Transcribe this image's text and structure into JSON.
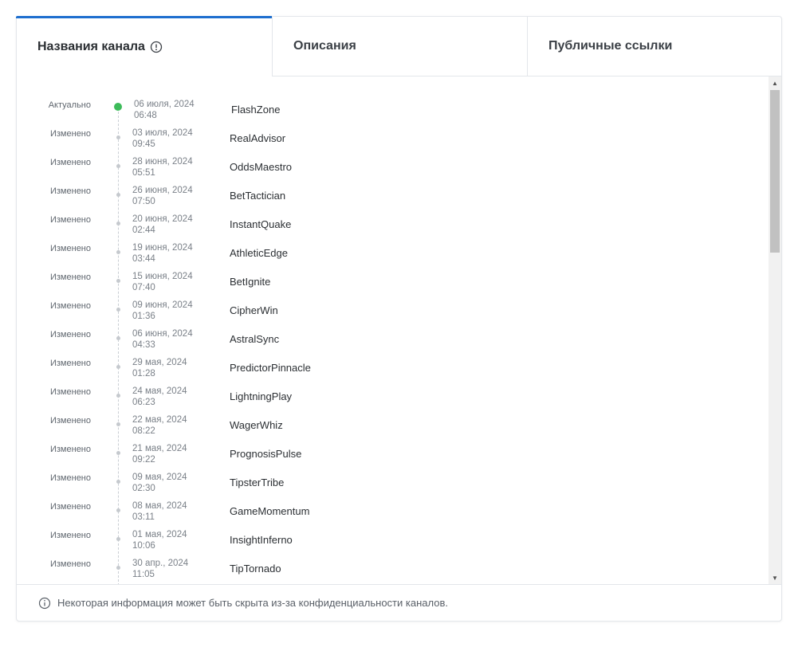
{
  "tabs": [
    {
      "label": "Названия канала",
      "active": true
    },
    {
      "label": "Описания",
      "active": false
    },
    {
      "label": "Публичные ссылки",
      "active": false
    }
  ],
  "history": [
    {
      "status": "Актуально",
      "date": "06 июля, 2024",
      "time": "06:48",
      "name": "FlashZone",
      "current": true
    },
    {
      "status": "Изменено",
      "date": "03 июля, 2024",
      "time": "09:45",
      "name": "RealAdvisor"
    },
    {
      "status": "Изменено",
      "date": "28 июня, 2024",
      "time": "05:51",
      "name": "OddsMaestro"
    },
    {
      "status": "Изменено",
      "date": "26 июня, 2024",
      "time": "07:50",
      "name": "BetTactician"
    },
    {
      "status": "Изменено",
      "date": "20 июня, 2024",
      "time": "02:44",
      "name": "InstantQuake"
    },
    {
      "status": "Изменено",
      "date": "19 июня, 2024",
      "time": "03:44",
      "name": "AthleticEdge"
    },
    {
      "status": "Изменено",
      "date": "15 июня, 2024",
      "time": "07:40",
      "name": "BetIgnite"
    },
    {
      "status": "Изменено",
      "date": "09 июня, 2024",
      "time": "01:36",
      "name": "CipherWin"
    },
    {
      "status": "Изменено",
      "date": "06 июня, 2024",
      "time": "04:33",
      "name": "AstralSync"
    },
    {
      "status": "Изменено",
      "date": "29 мая, 2024",
      "time": "01:28",
      "name": "PredictorPinnacle"
    },
    {
      "status": "Изменено",
      "date": "24 мая, 2024",
      "time": "06:23",
      "name": "LightningPlay"
    },
    {
      "status": "Изменено",
      "date": "22 мая, 2024",
      "time": "08:22",
      "name": "WagerWhiz"
    },
    {
      "status": "Изменено",
      "date": "21 мая, 2024",
      "time": "09:22",
      "name": "PrognosisPulse"
    },
    {
      "status": "Изменено",
      "date": "09 мая, 2024",
      "time": "02:30",
      "name": "TipsterTribe"
    },
    {
      "status": "Изменено",
      "date": "08 мая, 2024",
      "time": "03:11",
      "name": "GameMomentum"
    },
    {
      "status": "Изменено",
      "date": "01 мая, 2024",
      "time": "10:06",
      "name": "InsightInferno"
    },
    {
      "status": "Изменено",
      "date": "30 апр., 2024",
      "time": "11:05",
      "name": "TipTornado"
    }
  ],
  "footer": {
    "text": "Некоторая информация может быть скрыта из-за конфиденциальности каналов."
  },
  "colors": {
    "accent": "#1e6fcf",
    "current_dot": "#3dbb5a",
    "past_dot": "#c5c9ce"
  },
  "icons": {
    "tab_info": "info-circle-icon",
    "footer_info": "info-circle-icon"
  }
}
